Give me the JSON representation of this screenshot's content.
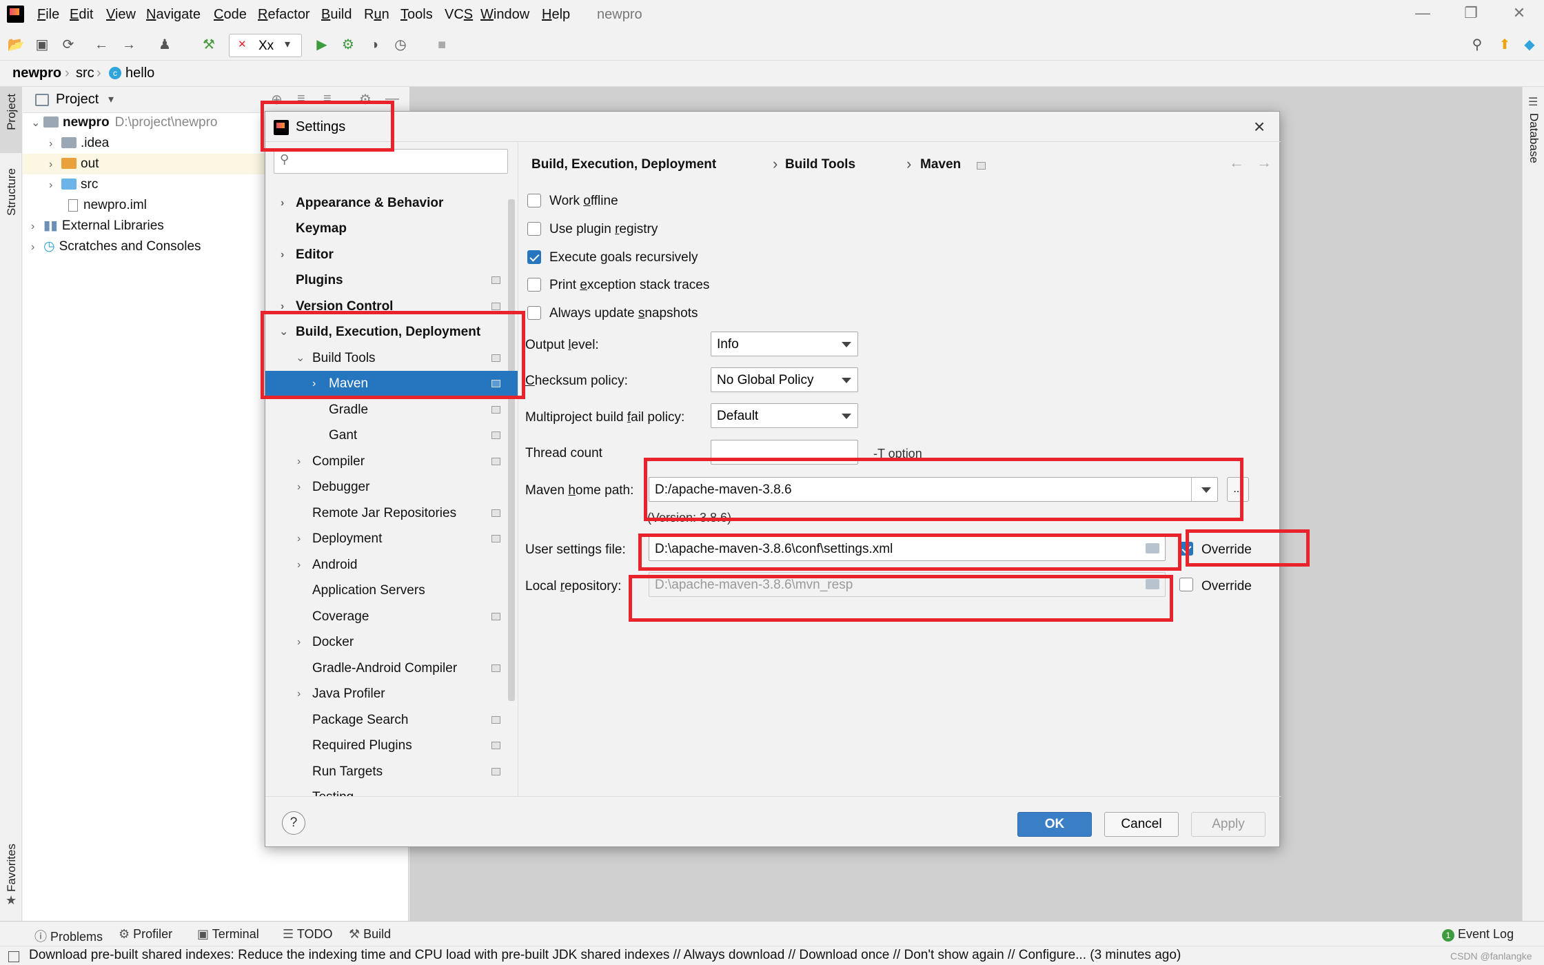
{
  "menubar": {
    "items": [
      {
        "pre": "",
        "u": "F",
        "post": "ile"
      },
      {
        "pre": "",
        "u": "E",
        "post": "dit"
      },
      {
        "pre": "",
        "u": "V",
        "post": "iew"
      },
      {
        "pre": "",
        "u": "N",
        "post": "avigate"
      },
      {
        "pre": "",
        "u": "C",
        "post": "ode"
      },
      {
        "pre": "",
        "u": "R",
        "post": "efactor"
      },
      {
        "pre": "",
        "u": "B",
        "post": "uild"
      },
      {
        "pre": "R",
        "u": "u",
        "post": "n"
      },
      {
        "pre": "",
        "u": "T",
        "post": "ools"
      },
      {
        "pre": "VC",
        "u": "S",
        "post": ""
      },
      {
        "pre": "",
        "u": "W",
        "post": "indow"
      },
      {
        "pre": "",
        "u": "H",
        "post": "elp"
      }
    ],
    "project_title": "newpro"
  },
  "toolbar": {
    "run_config": "Xx"
  },
  "breadcrumb": {
    "root": "newpro",
    "folder": "src",
    "file": "hello"
  },
  "left_strip": {
    "project": "Project",
    "structure": "Structure",
    "favorites": "Favorites"
  },
  "right_strip": {
    "database": "Database"
  },
  "project_panel": {
    "title": "Project",
    "tree": {
      "root": "newpro",
      "root_path": "D:\\project\\newpro",
      "idea": ".idea",
      "out": "out",
      "src": "src",
      "iml": "newpro.iml",
      "ext": "External Libraries",
      "scratch": "Scratches and Consoles"
    }
  },
  "dialog": {
    "title": "Settings",
    "nav": [
      "Appearance & Behavior",
      "Keymap",
      "Editor",
      "Plugins",
      "Version Control",
      "Build, Execution, Deployment",
      "Build Tools",
      "Maven",
      "Gradle",
      "Gant",
      "Compiler",
      "Debugger",
      "Remote Jar Repositories",
      "Deployment",
      "Android",
      "Application Servers",
      "Coverage",
      "Docker",
      "Gradle-Android Compiler",
      "Java Profiler",
      "Package Search",
      "Required Plugins",
      "Run Targets",
      "Testing"
    ],
    "crumb": {
      "a": "Build, Execution, Deployment",
      "b": "Build Tools",
      "c": "Maven"
    },
    "options": {
      "work_offline": {
        "pre": "Work ",
        "u": "o",
        "post": "ffline",
        "checked": false
      },
      "plugin_registry": {
        "pre": "Use plugin ",
        "u": "r",
        "post": "egistry",
        "checked": false
      },
      "recursive": {
        "pre": "Execute ",
        "u": "g",
        "post": "oals recursively",
        "checked": true
      },
      "stack_traces": {
        "pre": "Print ",
        "u": "e",
        "post": "xception stack traces",
        "checked": false
      },
      "snapshots": {
        "pre": "Always update ",
        "u": "s",
        "post": "napshots",
        "checked": false
      }
    },
    "fields": {
      "output_level": {
        "pre": "Output ",
        "u": "l",
        "post": "evel:",
        "value": "Info"
      },
      "checksum": {
        "pre": "",
        "u": "C",
        "post": "hecksum policy:",
        "value": "No Global Policy"
      },
      "fail_policy": {
        "pre": "Multiproject build ",
        "u": "f",
        "post": "ail policy:",
        "value": "Default"
      },
      "thread_count": {
        "label": "Thread count",
        "value": "",
        "hint": "-T option"
      },
      "maven_home": {
        "pre": "Maven ",
        "u": "h",
        "post": "ome path:",
        "value": "D:/apache-maven-3.8.6",
        "version": "(Version: 3.8.6)",
        "browse": "..."
      },
      "user_settings": {
        "label": "User settings file:",
        "value": "D:\\apache-maven-3.8.6\\conf\\settings.xml",
        "override": "Override",
        "override_checked": true
      },
      "local_repo": {
        "pre": "Local ",
        "u": "r",
        "post": "epository:",
        "value": "D:\\apache-maven-3.8.6\\mvn_resp",
        "override": "Override",
        "override_checked": false
      }
    },
    "buttons": {
      "help": "?",
      "ok": "OK",
      "cancel": "Cancel",
      "apply": "Apply"
    }
  },
  "bottom_tools": {
    "problems": "Problems",
    "profiler": "Profiler",
    "terminal": "Terminal",
    "todo": "TODO",
    "build": "Build",
    "event_log": "Event Log",
    "event_count": "1"
  },
  "status": {
    "message": "Download pre-built shared indexes: Reduce the indexing time and CPU load with pre-built JDK shared indexes // Always download // Download once // Don't show again // Configure... (3 minutes ago)",
    "watermark": "CSDN @fanlangke"
  },
  "colors": {
    "accent": "#2675bf",
    "annotation": "#e8232c"
  }
}
